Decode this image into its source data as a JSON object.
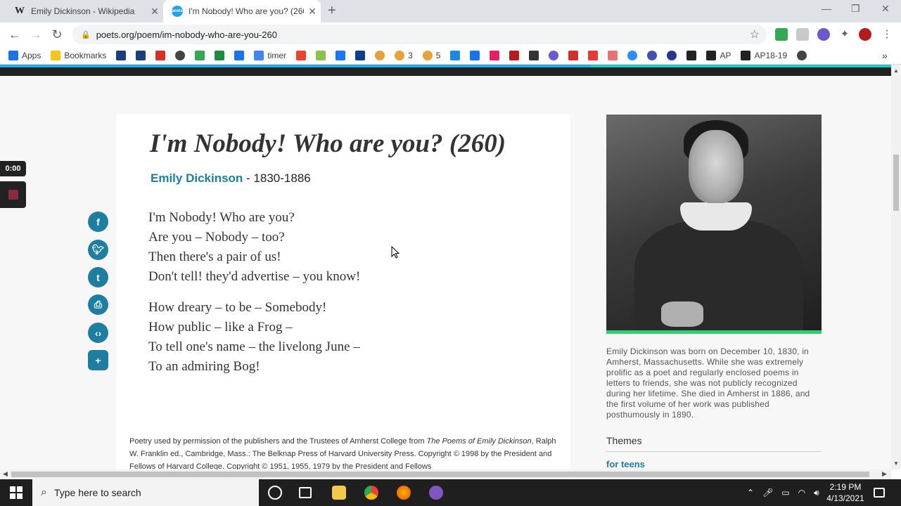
{
  "browser": {
    "tabs": [
      {
        "title": "Emily Dickinson - Wikipedia",
        "favicon": "W",
        "active": false
      },
      {
        "title": "I'm Nobody! Who are you? (260)",
        "favicon": "poets",
        "active": true
      }
    ],
    "url": "poets.org/poem/im-nobody-who-are-you-260",
    "bookmarks": [
      {
        "label": "Apps",
        "icon": "apps-grid-icon",
        "color": "#1a73e8"
      },
      {
        "label": "Bookmarks",
        "icon": "folder-icon",
        "color": "#f5c518"
      },
      {
        "label": "",
        "icon": "sis-icon",
        "color": "#1a3f7a"
      },
      {
        "label": "",
        "icon": "sis-icon",
        "color": "#1a3f7a"
      },
      {
        "label": "",
        "icon": "gmail-icon",
        "color": "#d93025"
      },
      {
        "label": "",
        "icon": "globe-icon",
        "color": "#444444"
      },
      {
        "label": "",
        "icon": "drive-icon",
        "color": "#34a853"
      },
      {
        "label": "",
        "icon": "classroom-icon",
        "color": "#1e8e3e"
      },
      {
        "label": "",
        "icon": "calendar-icon",
        "color": "#1a73e8"
      },
      {
        "label": "timer",
        "icon": "google-icon",
        "color": "#4285f4"
      },
      {
        "label": "",
        "icon": "swoosh-icon",
        "color": "#e8452c"
      },
      {
        "label": "",
        "icon": "sheet-icon",
        "color": "#8bc34a"
      },
      {
        "label": "",
        "icon": "facebook-icon",
        "color": "#1877f2"
      },
      {
        "label": "",
        "icon": "news-icon",
        "color": "#0b3d91"
      },
      {
        "label": "",
        "icon": "chart-icon",
        "color": "#e8a13a"
      },
      {
        "label": "3",
        "icon": "chart-icon",
        "color": "#e8a13a"
      },
      {
        "label": "5",
        "icon": "chart-icon",
        "color": "#e8a13a"
      },
      {
        "label": "",
        "icon": "f-icon",
        "color": "#1e88e5"
      },
      {
        "label": "",
        "icon": "chat-icon",
        "color": "#1a73e8"
      },
      {
        "label": "",
        "icon": "badge-icon",
        "color": "#e91e63"
      },
      {
        "label": "",
        "icon": "b-icon",
        "color": "#b71c1c"
      },
      {
        "label": "",
        "icon": "pen-icon",
        "color": "#333333"
      },
      {
        "label": "",
        "icon": "flower-icon",
        "color": "#6a5acd"
      },
      {
        "label": "",
        "icon": "pdf-icon",
        "color": "#d32f2f"
      },
      {
        "label": "",
        "icon": "crop-icon",
        "color": "#e53935"
      },
      {
        "label": "",
        "icon": "book-icon",
        "color": "#e57373"
      },
      {
        "label": "",
        "icon": "zoom-icon",
        "color": "#2d8cff"
      },
      {
        "label": "",
        "icon": "c-icon",
        "color": "#3f51b5"
      },
      {
        "label": "",
        "icon": "k-icon",
        "color": "#283593"
      },
      {
        "label": "",
        "icon": "w-icon",
        "color": "#222222"
      },
      {
        "label": "AP",
        "icon": "w-icon",
        "color": "#222222"
      },
      {
        "label": "AP18-19",
        "icon": "w-icon",
        "color": "#222222"
      },
      {
        "label": "",
        "icon": "globe-icon",
        "color": "#444444"
      }
    ],
    "more_bookmarks": "»"
  },
  "recorder": {
    "time": "0:00"
  },
  "poem": {
    "title": "I'm Nobody! Who are you? (260)",
    "author": "Emily Dickinson",
    "dates": " - 1830-1886",
    "stanza1": [
      "I'm Nobody! Who are you?",
      "Are you – Nobody – too?",
      "Then there's a pair of us!",
      "Don't tell! they'd advertise – you know!"
    ],
    "stanza2": [
      "How dreary – to be – Somebody!",
      "How public – like a Frog –",
      "To tell one's name – the livelong June –",
      "To an admiring Bog!"
    ],
    "credit_prefix": "Poetry used by permission of the publishers and the Trustees of Amherst College from ",
    "credit_book": "The Poems of Emily Dickinson",
    "credit_suffix": ", Ralph W. Franklin ed., Cambridge, Mass.: The Belknap Press of Harvard University Press. Copyright © 1998 by the President and Fellows of Harvard College. Copyright © 1951, 1955, 1979 by the President and Fellows"
  },
  "share": [
    {
      "name": "facebook",
      "glyph": "f"
    },
    {
      "name": "twitter",
      "glyph": "t"
    },
    {
      "name": "tumblr",
      "glyph": "t"
    },
    {
      "name": "print",
      "glyph": "⎙"
    },
    {
      "name": "embed",
      "glyph": "‹›"
    },
    {
      "name": "bookmark",
      "glyph": "+"
    }
  ],
  "sidebar": {
    "bio": "Emily Dickinson was born on December 10, 1830, in Amherst, Massachusetts. While she was extremely prolific as a poet and regularly enclosed poems in letters to friends, she was not publicly recognized during her lifetime. She died in Amherst in 1886, and the first volume of her work was published posthumously in 1890.",
    "themes_heading": "Themes",
    "theme_link": "for teens"
  },
  "taskbar": {
    "search_placeholder": "Type here to search",
    "time": "2:19 PM",
    "date": "4/13/2021"
  }
}
